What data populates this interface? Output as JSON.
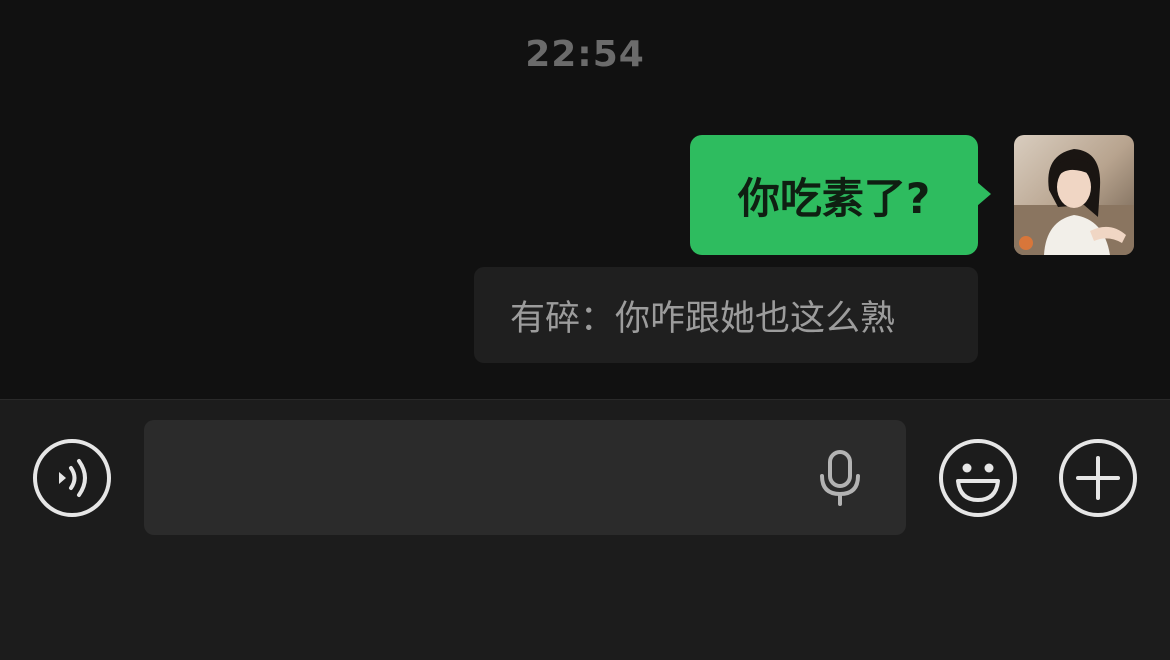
{
  "chat": {
    "timestamp": "22:54",
    "messages": [
      {
        "sender": "self",
        "text": "你吃素了?"
      }
    ],
    "quote": {
      "text": "有碎：你咋跟她也这么熟"
    }
  },
  "input_bar": {
    "text_input": {
      "value": "",
      "placeholder": ""
    },
    "buttons": [
      "voice-mode-icon",
      "microphone-icon",
      "emoji-icon",
      "plus-icon"
    ]
  },
  "colors": {
    "background": "#111111",
    "bubble_self": "#2ebc5f",
    "quote_background": "#1f1f1f",
    "input_bar": "#1c1c1c",
    "input_field": "#2b2b2b",
    "icon": "#e6e6e6"
  }
}
